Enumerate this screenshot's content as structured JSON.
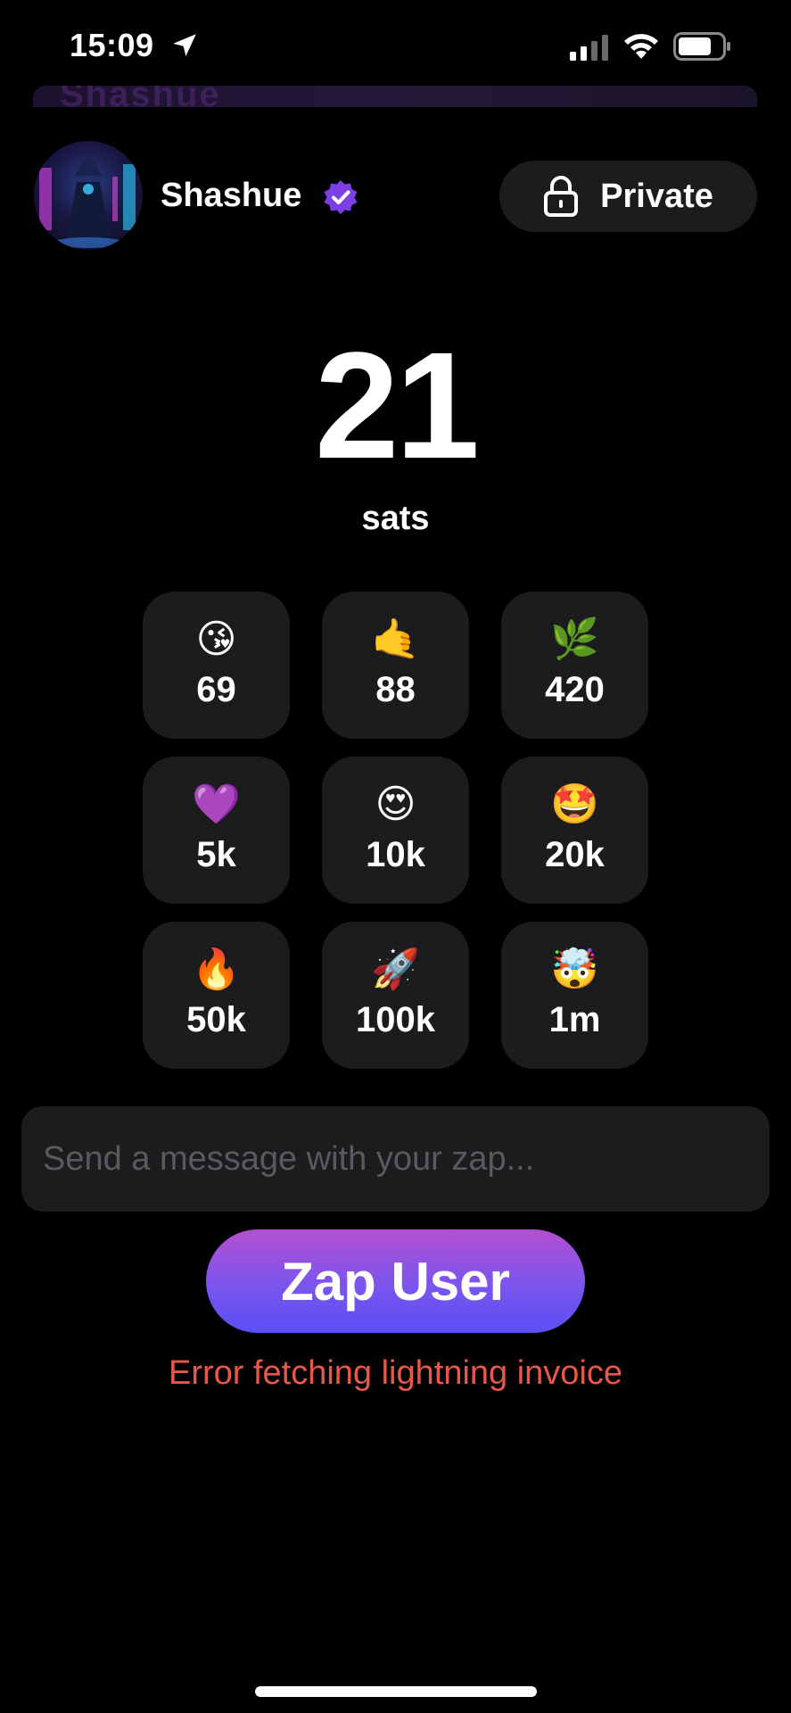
{
  "status_bar": {
    "time": "15:09",
    "icons": [
      "location-arrow-icon",
      "signal-icon",
      "wifi-icon",
      "battery-icon"
    ]
  },
  "banner": {
    "text": "Shashue"
  },
  "profile": {
    "name": "Shashue",
    "verified": true,
    "verified_color": "#7b3fe4",
    "privacy_label": "Private"
  },
  "amount": {
    "value": "21",
    "unit": "sats"
  },
  "presets": [
    {
      "emoji": "😘",
      "value": "69"
    },
    {
      "emoji": "🤙",
      "value": "88"
    },
    {
      "emoji": "🌿",
      "value": "420"
    },
    {
      "emoji": "💜",
      "value": "5k"
    },
    {
      "emoji": "😍",
      "value": "10k"
    },
    {
      "emoji": "🤩",
      "value": "20k"
    },
    {
      "emoji": "🔥",
      "value": "50k"
    },
    {
      "emoji": "🚀",
      "value": "100k"
    },
    {
      "emoji": "🤯",
      "value": "1m"
    }
  ],
  "message": {
    "placeholder": "Send a message with your zap...",
    "value": ""
  },
  "zap_button": {
    "label": "Zap User"
  },
  "error": {
    "text": "Error fetching lightning invoice",
    "color": "#e8584a"
  },
  "colors": {
    "background": "#000000",
    "tile": "#1c1c1e",
    "accent_start": "#b34fd0",
    "accent_end": "#5a4ff5"
  }
}
